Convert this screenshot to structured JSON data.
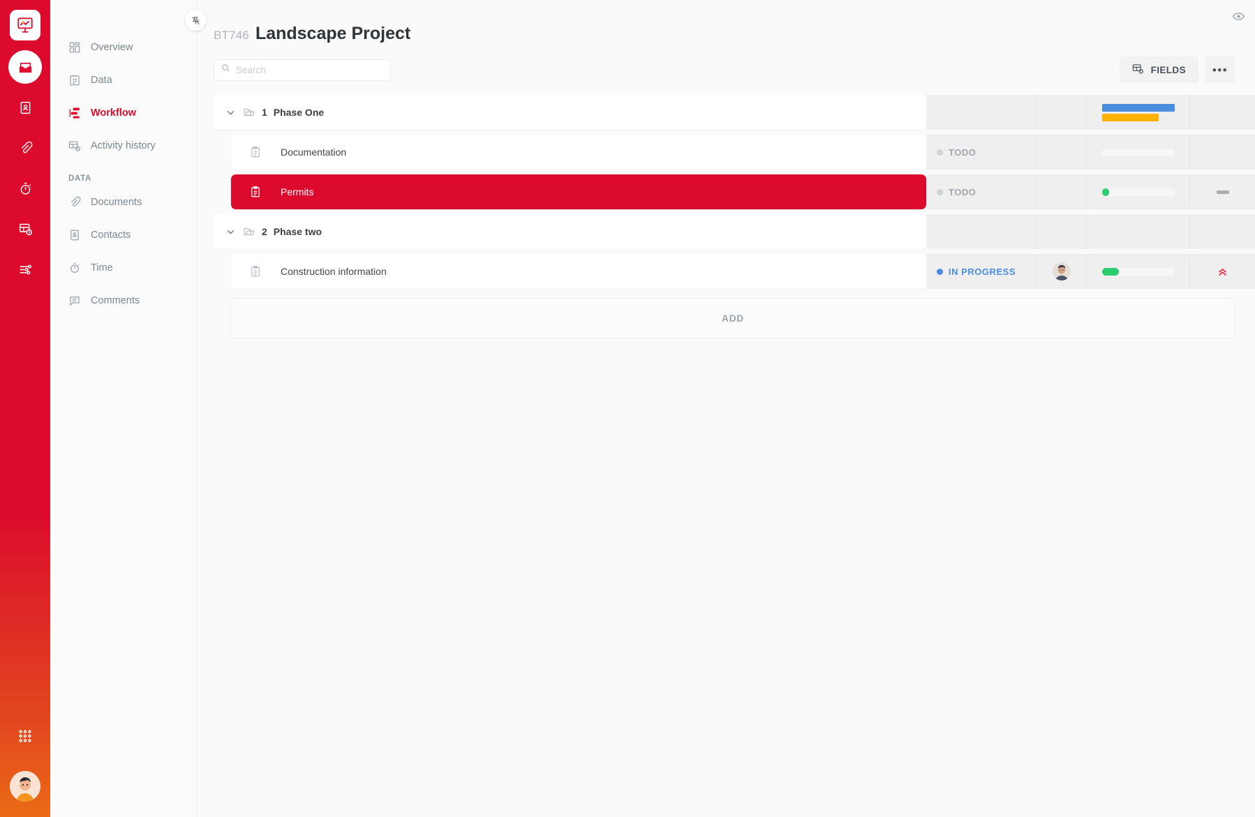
{
  "rail": {
    "logo_icon": "easel-chart-logo",
    "items": [
      {
        "name": "file-box-icon",
        "active": true
      },
      {
        "name": "contacts-book-icon",
        "active": false
      },
      {
        "name": "paperclip-icon",
        "active": false
      },
      {
        "name": "stopwatch-icon",
        "active": false
      },
      {
        "name": "activity-history-icon",
        "active": false
      },
      {
        "name": "sliders-icon",
        "active": false
      }
    ],
    "grid_icon": "apps-grid-icon",
    "avatar_name": "user-avatar"
  },
  "nav": {
    "unpin_label": "unpin",
    "items": [
      {
        "label": "Overview",
        "icon": "overview-icon",
        "active": false
      },
      {
        "label": "Data",
        "icon": "data-icon",
        "active": false
      },
      {
        "label": "Workflow",
        "icon": "workflow-icon",
        "active": true
      },
      {
        "label": "Activity history",
        "icon": "activity-history-icon",
        "active": false
      }
    ],
    "group_title": "DATA",
    "group_items": [
      {
        "label": "Documents",
        "icon": "paperclip-icon"
      },
      {
        "label": "Contacts",
        "icon": "contacts-book-icon"
      },
      {
        "label": "Time",
        "icon": "stopwatch-icon"
      },
      {
        "label": "Comments",
        "icon": "comments-icon"
      }
    ]
  },
  "header": {
    "project_key": "BT746",
    "project_title": "Landscape Project",
    "eye_icon": "eye-icon"
  },
  "search": {
    "value": "",
    "placeholder": "Search",
    "icon": "search-icon"
  },
  "toolbar": {
    "fields_label": "FIELDS",
    "fields_icon": "table-settings-icon",
    "more_label": "•••"
  },
  "table": {
    "rows": [
      {
        "type": "phase",
        "number": "1",
        "name": "Phase One",
        "icon": "folder-icon",
        "chevron": "chevron-down-icon",
        "status": "",
        "status_type": "none",
        "assignee": false,
        "progress_type": "dual",
        "progress_blue_pct": 100,
        "progress_orange_pct": 78,
        "priority": "none",
        "selected": false
      },
      {
        "type": "task",
        "name": "Documentation",
        "icon": "clipboard-icon",
        "status": "TODO",
        "status_type": "todo",
        "assignee": false,
        "progress_type": "empty",
        "progress_pct": 0,
        "priority": "none",
        "selected": false
      },
      {
        "type": "task",
        "name": "Permits",
        "icon": "clipboard-icon",
        "status": "TODO",
        "status_type": "todo",
        "assignee": false,
        "progress_type": "single",
        "progress_pct": 10,
        "priority": "medium",
        "selected": true
      },
      {
        "type": "phase",
        "number": "2",
        "name": "Phase two",
        "icon": "folder-icon",
        "chevron": "chevron-down-icon",
        "status": "",
        "status_type": "none",
        "assignee": false,
        "progress_type": "none",
        "priority": "none",
        "selected": false
      },
      {
        "type": "task",
        "name": "Construction information",
        "icon": "clipboard-icon",
        "status": "IN PROGRESS",
        "status_type": "in-progress",
        "assignee": true,
        "progress_type": "single",
        "progress_pct": 24,
        "priority": "high",
        "selected": false
      }
    ],
    "add_label": "ADD"
  },
  "colors": {
    "brand_red": "#DC0A2D",
    "status_blue": "#4A8CDE",
    "progress_green": "#2ECC71",
    "bar_orange": "#FFB300",
    "priority_high": "#E8233E"
  }
}
